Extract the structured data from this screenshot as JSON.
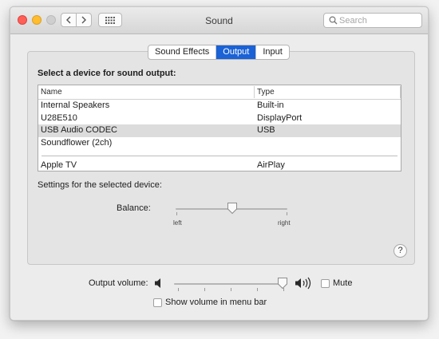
{
  "window": {
    "title": "Sound"
  },
  "search": {
    "placeholder": "Search",
    "value": ""
  },
  "tabs": [
    {
      "label": "Sound Effects",
      "active": false
    },
    {
      "label": "Output",
      "active": true
    },
    {
      "label": "Input",
      "active": false
    }
  ],
  "output": {
    "heading": "Select a device for sound output:",
    "columns": {
      "name": "Name",
      "type": "Type"
    },
    "devices": [
      {
        "name": "Internal Speakers",
        "type": "Built-in",
        "selected": false
      },
      {
        "name": "U28E510",
        "type": "DisplayPort",
        "selected": false
      },
      {
        "name": "USB Audio CODEC",
        "type": "USB",
        "selected": true
      },
      {
        "name": "Soundflower (2ch)",
        "type": "",
        "selected": false
      },
      {
        "name": "Apple TV",
        "type": "AirPlay",
        "selected": false
      }
    ],
    "settings_label": "Settings for the selected device:",
    "balance": {
      "label": "Balance:",
      "left": "left",
      "right": "right",
      "value": 0.5
    }
  },
  "help": {
    "label": "?"
  },
  "volume": {
    "label": "Output volume:",
    "value": 0.95,
    "mute_label": "Mute",
    "mute_checked": false,
    "show_in_menu_bar_label": "Show volume in menu bar",
    "show_in_menu_bar_checked": false
  },
  "colors": {
    "accent": "#1a62d6",
    "close": "#fe5f57",
    "minimize": "#febc2e",
    "zoom_inactive": "#cfcfcf"
  },
  "icons": [
    "back-chevron-icon",
    "forward-chevron-icon",
    "grid-icon",
    "search-icon",
    "speaker-low-icon",
    "speaker-high-icon",
    "help-icon"
  ]
}
